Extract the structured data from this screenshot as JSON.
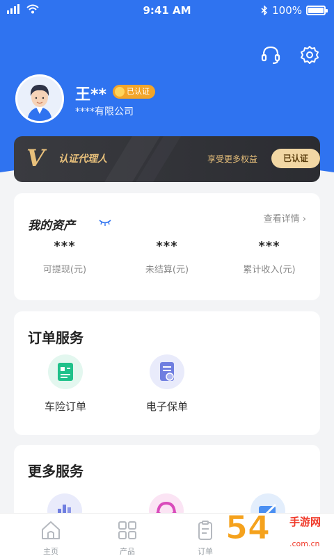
{
  "status_bar": {
    "time": "9:41 AM",
    "battery": "100%"
  },
  "profile": {
    "name": "王**",
    "verified_label": "已认证",
    "company": "****有限公司"
  },
  "agent_card": {
    "logo": "V",
    "title": "认证代理人",
    "benefit_text": "享受更多权益",
    "button_label": "已认证"
  },
  "assets": {
    "title": "我的资产",
    "detail_link": "查看详情",
    "items": [
      {
        "value": "***",
        "label": "可提现(元)"
      },
      {
        "value": "***",
        "label": "未结算(元)"
      },
      {
        "value": "***",
        "label": "累计收入(元)"
      }
    ]
  },
  "order_service": {
    "title": "订单服务",
    "items": [
      {
        "label": "车险订单",
        "icon": "car-insurance-order-icon"
      },
      {
        "label": "电子保单",
        "icon": "e-policy-icon"
      }
    ]
  },
  "more_service": {
    "title": "更多服务",
    "items": [
      {
        "icon": "chart-icon"
      },
      {
        "icon": "headset-service-icon"
      },
      {
        "icon": "card-edit-icon"
      }
    ]
  },
  "bottom_nav": {
    "items": [
      {
        "label": "主页",
        "icon": "home-icon"
      },
      {
        "label": "产品",
        "icon": "grid-icon"
      },
      {
        "label": "订单",
        "icon": "order-icon"
      }
    ]
  },
  "watermark": {
    "number": "54",
    "text_top": "手游网",
    "text_bottom": ".com.cn"
  },
  "colors": {
    "brand_blue": "#2f73f0",
    "gold": "#e8c07b",
    "badge_orange": "#f3a52a"
  }
}
